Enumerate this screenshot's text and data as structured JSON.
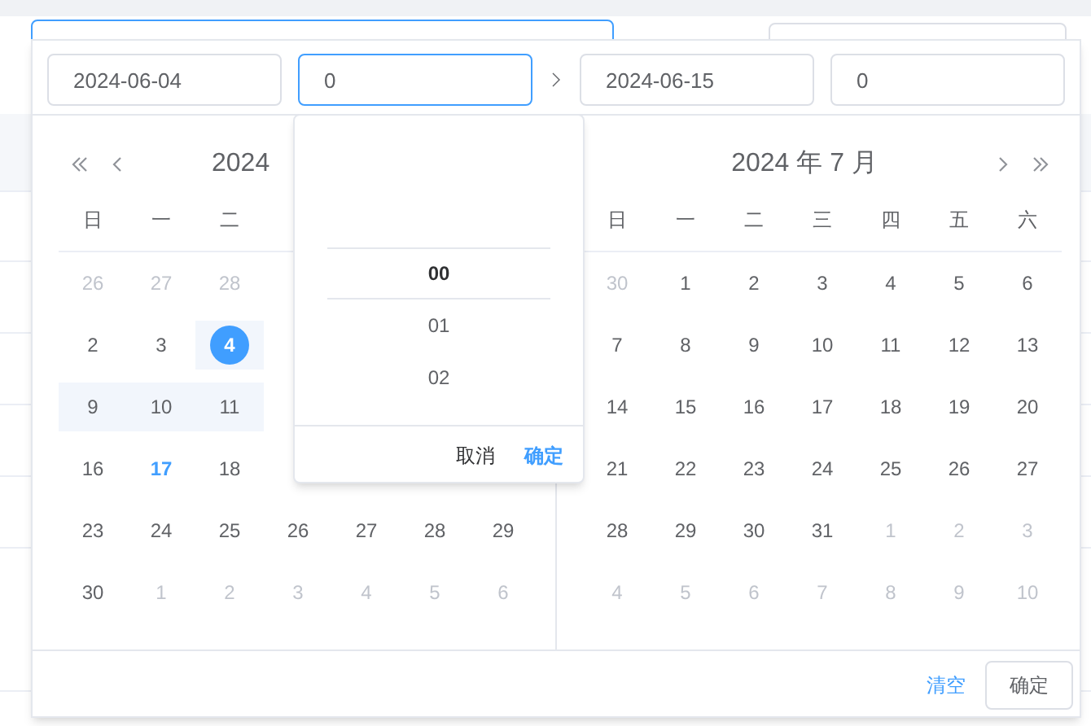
{
  "range_inputs": [
    {
      "value": "2024-06-04",
      "focused": false
    },
    {
      "value": "0",
      "focused": true
    },
    {
      "value": "2024-06-15",
      "focused": false
    },
    {
      "value": "0",
      "focused": false
    }
  ],
  "left_calendar": {
    "title": "2024",
    "weekdays": [
      "日",
      "一",
      "二"
    ],
    "weeks": [
      [
        {
          "text": "26",
          "kind": "other",
          "selected": false,
          "in_range": false
        },
        {
          "text": "27",
          "kind": "other",
          "selected": false,
          "in_range": false
        },
        {
          "text": "28",
          "kind": "other",
          "selected": false,
          "in_range": false
        }
      ],
      [
        {
          "text": "2",
          "kind": "day",
          "selected": false,
          "in_range": false
        },
        {
          "text": "3",
          "kind": "day",
          "selected": false,
          "in_range": false
        },
        {
          "text": "4",
          "kind": "day",
          "selected": true,
          "in_range": true
        }
      ],
      [
        {
          "text": "9",
          "kind": "day",
          "selected": false,
          "in_range": true
        },
        {
          "text": "10",
          "kind": "day",
          "selected": false,
          "in_range": true
        },
        {
          "text": "11",
          "kind": "day",
          "selected": false,
          "in_range": true
        }
      ],
      [
        {
          "text": "16",
          "kind": "day",
          "selected": false,
          "in_range": false
        },
        {
          "text": "17",
          "kind": "today",
          "selected": false,
          "in_range": false
        },
        {
          "text": "18",
          "kind": "day",
          "selected": false,
          "in_range": false
        }
      ],
      [
        {
          "text": "23",
          "kind": "day",
          "selected": false,
          "in_range": false
        },
        {
          "text": "24",
          "kind": "day",
          "selected": false,
          "in_range": false
        },
        {
          "text": "25",
          "kind": "day",
          "selected": false,
          "in_range": false
        },
        {
          "text": "26",
          "kind": "day",
          "selected": false,
          "in_range": false
        },
        {
          "text": "27",
          "kind": "day",
          "selected": false,
          "in_range": false
        },
        {
          "text": "28",
          "kind": "day",
          "selected": false,
          "in_range": false
        },
        {
          "text": "29",
          "kind": "day",
          "selected": false,
          "in_range": false
        }
      ],
      [
        {
          "text": "30",
          "kind": "day",
          "selected": false,
          "in_range": false
        },
        {
          "text": "1",
          "kind": "other",
          "selected": false,
          "in_range": false
        },
        {
          "text": "2",
          "kind": "other",
          "selected": false,
          "in_range": false
        },
        {
          "text": "3",
          "kind": "other",
          "selected": false,
          "in_range": false
        },
        {
          "text": "4",
          "kind": "other",
          "selected": false,
          "in_range": false
        },
        {
          "text": "5",
          "kind": "other",
          "selected": false,
          "in_range": false
        },
        {
          "text": "6",
          "kind": "other",
          "selected": false,
          "in_range": false
        }
      ]
    ]
  },
  "right_calendar": {
    "title": "2024 年 7 月",
    "weekdays": [
      "日",
      "一",
      "二",
      "三",
      "四",
      "五",
      "六"
    ],
    "weeks": [
      [
        {
          "text": "30",
          "kind": "other"
        },
        {
          "text": "1",
          "kind": "day"
        },
        {
          "text": "2",
          "kind": "day"
        },
        {
          "text": "3",
          "kind": "day"
        },
        {
          "text": "4",
          "kind": "day"
        },
        {
          "text": "5",
          "kind": "day"
        },
        {
          "text": "6",
          "kind": "day"
        }
      ],
      [
        {
          "text": "7",
          "kind": "day"
        },
        {
          "text": "8",
          "kind": "day"
        },
        {
          "text": "9",
          "kind": "day"
        },
        {
          "text": "10",
          "kind": "day"
        },
        {
          "text": "11",
          "kind": "day"
        },
        {
          "text": "12",
          "kind": "day"
        },
        {
          "text": "13",
          "kind": "day"
        }
      ],
      [
        {
          "text": "14",
          "kind": "day"
        },
        {
          "text": "15",
          "kind": "day"
        },
        {
          "text": "16",
          "kind": "day"
        },
        {
          "text": "17",
          "kind": "day"
        },
        {
          "text": "18",
          "kind": "day"
        },
        {
          "text": "19",
          "kind": "day"
        },
        {
          "text": "20",
          "kind": "day"
        }
      ],
      [
        {
          "text": "21",
          "kind": "day"
        },
        {
          "text": "22",
          "kind": "day"
        },
        {
          "text": "23",
          "kind": "day"
        },
        {
          "text": "24",
          "kind": "day"
        },
        {
          "text": "25",
          "kind": "day"
        },
        {
          "text": "26",
          "kind": "day"
        },
        {
          "text": "27",
          "kind": "day"
        }
      ],
      [
        {
          "text": "28",
          "kind": "day"
        },
        {
          "text": "29",
          "kind": "day"
        },
        {
          "text": "30",
          "kind": "day"
        },
        {
          "text": "31",
          "kind": "day"
        },
        {
          "text": "1",
          "kind": "other"
        },
        {
          "text": "2",
          "kind": "other"
        },
        {
          "text": "3",
          "kind": "other"
        }
      ],
      [
        {
          "text": "4",
          "kind": "other"
        },
        {
          "text": "5",
          "kind": "other"
        },
        {
          "text": "6",
          "kind": "other"
        },
        {
          "text": "7",
          "kind": "other"
        },
        {
          "text": "8",
          "kind": "other"
        },
        {
          "text": "9",
          "kind": "other"
        },
        {
          "text": "10",
          "kind": "other"
        }
      ]
    ]
  },
  "time_spinner": {
    "options": [
      {
        "text": "00",
        "selected": true
      },
      {
        "text": "01",
        "selected": false
      },
      {
        "text": "02",
        "selected": false
      }
    ],
    "cancel": "取消",
    "confirm": "确定"
  },
  "footer": {
    "clear": "清空",
    "confirm": "确定"
  }
}
